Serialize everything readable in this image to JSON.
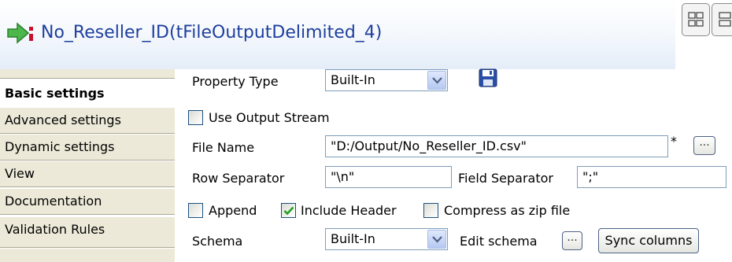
{
  "title": {
    "text": "No_Reseller_ID(tFileOutputDelimited_4)"
  },
  "tabs": [
    {
      "label": "Basic settings"
    },
    {
      "label": "Advanced settings"
    },
    {
      "label": "Dynamic settings"
    },
    {
      "label": "View"
    },
    {
      "label": "Documentation"
    },
    {
      "label": "Validation Rules"
    }
  ],
  "form": {
    "property_type_label": "Property Type",
    "property_type_value": "Built-In",
    "use_output_stream_label": "Use Output Stream",
    "use_output_stream_checked": false,
    "file_name_label": "File Name",
    "file_name_value": "\"D:/Output/No_Reseller_ID.csv\"",
    "file_name_modified_marker": "*",
    "browse_button_label": "...",
    "row_separator_label": "Row Separator",
    "row_separator_value": "\"\\n\"",
    "field_separator_label": "Field Separator",
    "field_separator_value": "\";\"",
    "append_label": "Append",
    "append_checked": false,
    "include_header_label": "Include Header",
    "include_header_checked": true,
    "compress_label": "Compress as zip file",
    "compress_checked": false,
    "schema_label": "Schema",
    "schema_value": "Built-In",
    "edit_schema_label": "Edit schema",
    "edit_schema_button_label": "...",
    "sync_columns_label": "Sync columns"
  },
  "colors": {
    "title_text": "#1f3f9e",
    "tab_background": "#ece9d8",
    "checkmark": "#21a121",
    "save_icon": "#2a4fa8"
  }
}
